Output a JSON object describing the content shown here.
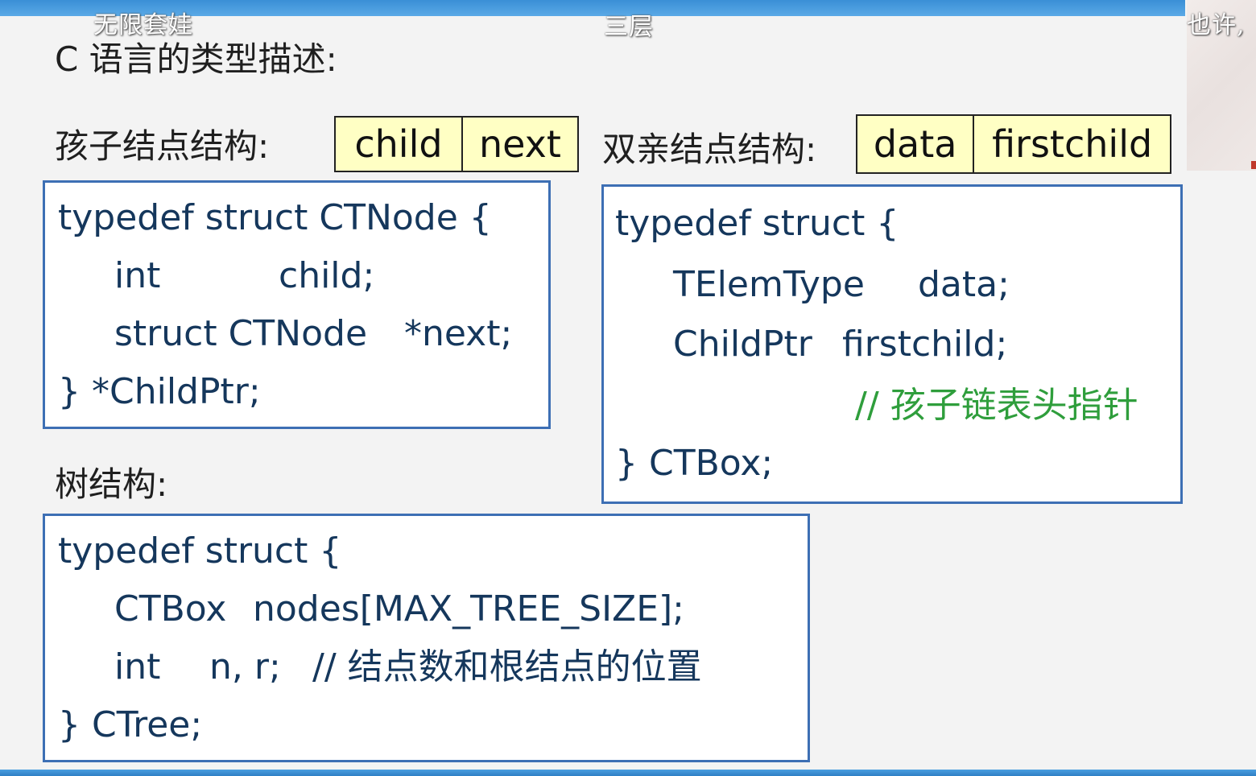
{
  "overlay": {
    "danmaku": [
      "无限套娃",
      "三层",
      "也许,"
    ]
  },
  "slide": {
    "title": "C 语言的类型描述:",
    "child_node": {
      "heading": "孩子结点结构:",
      "fields": [
        "child",
        "next"
      ],
      "code": {
        "l1": "typedef struct CTNode {",
        "l2_type": "int",
        "l2_name": "child;",
        "l3_type": "struct CTNode",
        "l3_name": "*next;",
        "l4": "} *ChildPtr;"
      }
    },
    "parent_node": {
      "heading": "双亲结点结构:",
      "fields": [
        "data",
        "firstchild"
      ],
      "code": {
        "l1": "typedef struct {",
        "l2_type": "TElemType",
        "l2_name": "data;",
        "l3_type": "ChildPtr",
        "l3_name": "firstchild;",
        "comment": "// 孩子链表头指针",
        "l5": "} CTBox;"
      }
    },
    "tree": {
      "heading": "树结构:",
      "code": {
        "l1": "typedef struct {",
        "l2_type": "CTBox",
        "l2_name": "nodes[MAX_TREE_SIZE];",
        "l3_type": "int",
        "l3_name": "n, r;",
        "l3_comment": "// 结点数和根结点的位置",
        "l4": "} CTree;"
      }
    }
  },
  "colors": {
    "box_border": "#3d6fb4",
    "field_fill": "#ffffc4",
    "code_text": "#15375c",
    "comment_green": "#2f9e3c"
  }
}
